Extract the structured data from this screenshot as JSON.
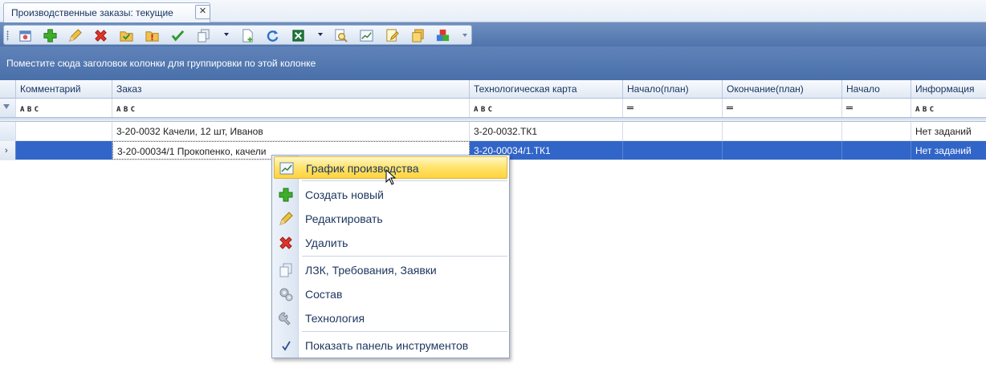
{
  "tab": {
    "title": "Производственные заказы: текущие",
    "close": "✕"
  },
  "toolbar": {
    "buttons": [
      {
        "name": "calendar-icon"
      },
      {
        "name": "add-icon"
      },
      {
        "name": "edit-pencil-icon"
      },
      {
        "name": "delete-icon"
      },
      {
        "name": "folder-check-icon"
      },
      {
        "name": "folder-warning-icon"
      },
      {
        "name": "checkmark-icon"
      },
      {
        "name": "copy-docs-icon"
      },
      {
        "name": "new-doc-icon"
      },
      {
        "name": "refresh-icon"
      },
      {
        "name": "excel-icon"
      },
      {
        "name": "search-doc-icon"
      },
      {
        "name": "production-chart-icon"
      },
      {
        "name": "edit-doc-icon"
      },
      {
        "name": "docs-icon"
      },
      {
        "name": "blocks-icon"
      }
    ]
  },
  "group_panel": {
    "text": "Поместите сюда заголовок колонки для группировки по этой колонке"
  },
  "grid": {
    "columns": [
      "Комментарий",
      "Заказ",
      "Технологическая карта",
      "Начало(план)",
      "Окончание(план)",
      "Начало",
      "Информация"
    ],
    "filter_text": "A B C",
    "filter_eq": "═",
    "rows": [
      {
        "comment": "",
        "order": "3-20-0032 Качели, 12 шт, Иванов",
        "techcard": "3-20-0032.ТК1",
        "start_plan": "",
        "end_plan": "",
        "start": "",
        "info": "Нет заданий"
      },
      {
        "comment": "",
        "order": "3-20-00034/1 Прокопенко, качели",
        "techcard": "3-20-00034/1.ТК1",
        "start_plan": "",
        "end_plan": "",
        "start": "",
        "info": "Нет заданий"
      }
    ],
    "current_row_marker": "›"
  },
  "context_menu": {
    "items": [
      {
        "label": "График производства",
        "icon": "production-chart-icon"
      },
      {
        "label": "Создать новый",
        "icon": "add-icon"
      },
      {
        "label": "Редактировать",
        "icon": "edit-pencil-icon"
      },
      {
        "label": "Удалить",
        "icon": "delete-icon"
      },
      {
        "label": "ЛЗК, Требования, Заявки",
        "icon": "copy-docs-icon"
      },
      {
        "label": "Состав",
        "icon": "gears-icon"
      },
      {
        "label": "Технология",
        "icon": "wrench-icon"
      },
      {
        "label": "Показать панель инструментов",
        "icon": "checkmark-icon"
      }
    ]
  }
}
